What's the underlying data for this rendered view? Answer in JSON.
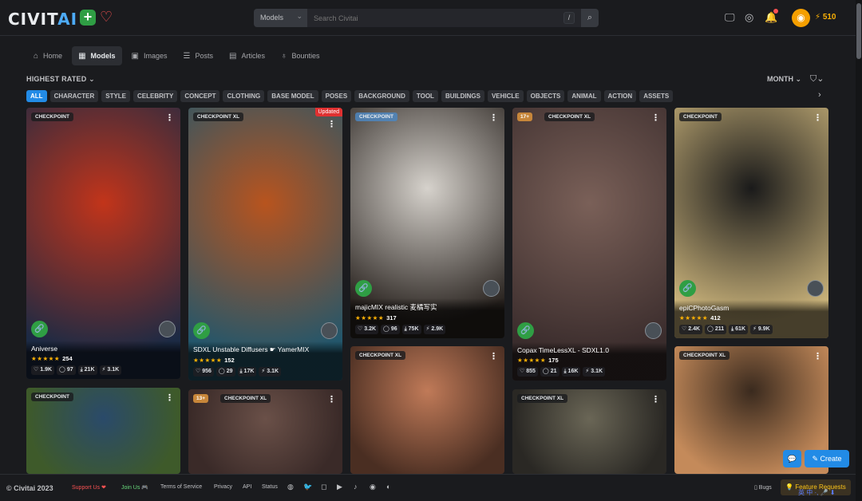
{
  "header": {
    "logo_main": "CIVIT",
    "logo_accent": "AI",
    "search_type": "Models",
    "search_placeholder": "Search Civitai",
    "slash_key": "/",
    "buzz_amount": "510"
  },
  "nav": [
    {
      "label": "Home",
      "icon": "home-icon"
    },
    {
      "label": "Models",
      "icon": "grid-icon"
    },
    {
      "label": "Images",
      "icon": "photo-icon"
    },
    {
      "label": "Posts",
      "icon": "layers-icon"
    },
    {
      "label": "Articles",
      "icon": "article-icon"
    },
    {
      "label": "Bounties",
      "icon": "moneybag-icon"
    }
  ],
  "sort": "HIGHEST RATED",
  "period": "MONTH",
  "tags": [
    "ALL",
    "CHARACTER",
    "STYLE",
    "CELEBRITY",
    "CONCEPT",
    "CLOTHING",
    "BASE MODEL",
    "POSES",
    "BACKGROUND",
    "TOOL",
    "BUILDINGS",
    "VEHICLE",
    "OBJECTS",
    "ANIMAL",
    "ACTION",
    "ASSETS"
  ],
  "cards": [
    {
      "type": "CHECKPOINT",
      "title": "Aniverse",
      "rating": "254",
      "likes": "1.9K",
      "comments": "97",
      "downloads": "21K",
      "buzz": "3.1K",
      "colors": [
        "#c2341a",
        "#1c2a44"
      ]
    },
    {
      "type": "CHECKPOINT XL",
      "title": "SDXL Unstable Diffusers ☛ YamerMIX",
      "rating": "152",
      "likes": "956",
      "comments": "29",
      "downloads": "17K",
      "buzz": "3.1K",
      "updated": "Updated",
      "colors": [
        "#b8541e",
        "#23566b"
      ]
    },
    {
      "type": "CHECKPOINT",
      "title": "majicMIX realistic 麦橘写实",
      "rating": "317",
      "likes": "3.2K",
      "comments": "96",
      "downloads": "75K",
      "buzz": "2.9K",
      "colors": [
        "#d6d2cc",
        "#2a2420"
      ]
    },
    {
      "type": "CHECKPOINT XL",
      "nsfw": "17+",
      "title": "Copax TimeLessXL - SDXL1.0",
      "rating": "175",
      "likes": "855",
      "comments": "21",
      "downloads": "16K",
      "buzz": "3.1K",
      "colors": [
        "#7a6058",
        "#3a2c2c"
      ]
    },
    {
      "type": "CHECKPOINT",
      "title": "epiCPhotoGasm",
      "rating": "412",
      "likes": "2.4K",
      "comments": "211",
      "downloads": "61K",
      "buzz": "9.9K",
      "colors": [
        "#1a1a1a",
        "#c9b27a"
      ]
    },
    {
      "type": "CHECKPOINT",
      "colors": [
        "#2a4a6a",
        "#3e5a2a"
      ]
    },
    {
      "type": "CHECKPOINT XL",
      "nsfw": "13+",
      "colors": [
        "#6a5048",
        "#3a2a28"
      ]
    },
    {
      "type": "CHECKPOINT XL",
      "colors": [
        "#c07a58",
        "#4a2e22"
      ]
    },
    {
      "type": "CHECKPOINT XL",
      "colors": [
        "#6a6656",
        "#2a2824"
      ]
    },
    {
      "type": "CHECKPOINT XL",
      "colors": [
        "#3a2a1e",
        "#c48a5a"
      ]
    }
  ],
  "footer": {
    "copyright": "© Civitai 2023",
    "support": "Support Us ❤",
    "join": "Join Us 🎮",
    "terms": "Terms of Service",
    "privacy": "Privacy",
    "api": "API",
    "status": "Status",
    "bugs": "Bugs",
    "feature": "Feature Requests"
  },
  "create_label": "Create",
  "tray": "英 中 ·, 🎤 ⬇"
}
